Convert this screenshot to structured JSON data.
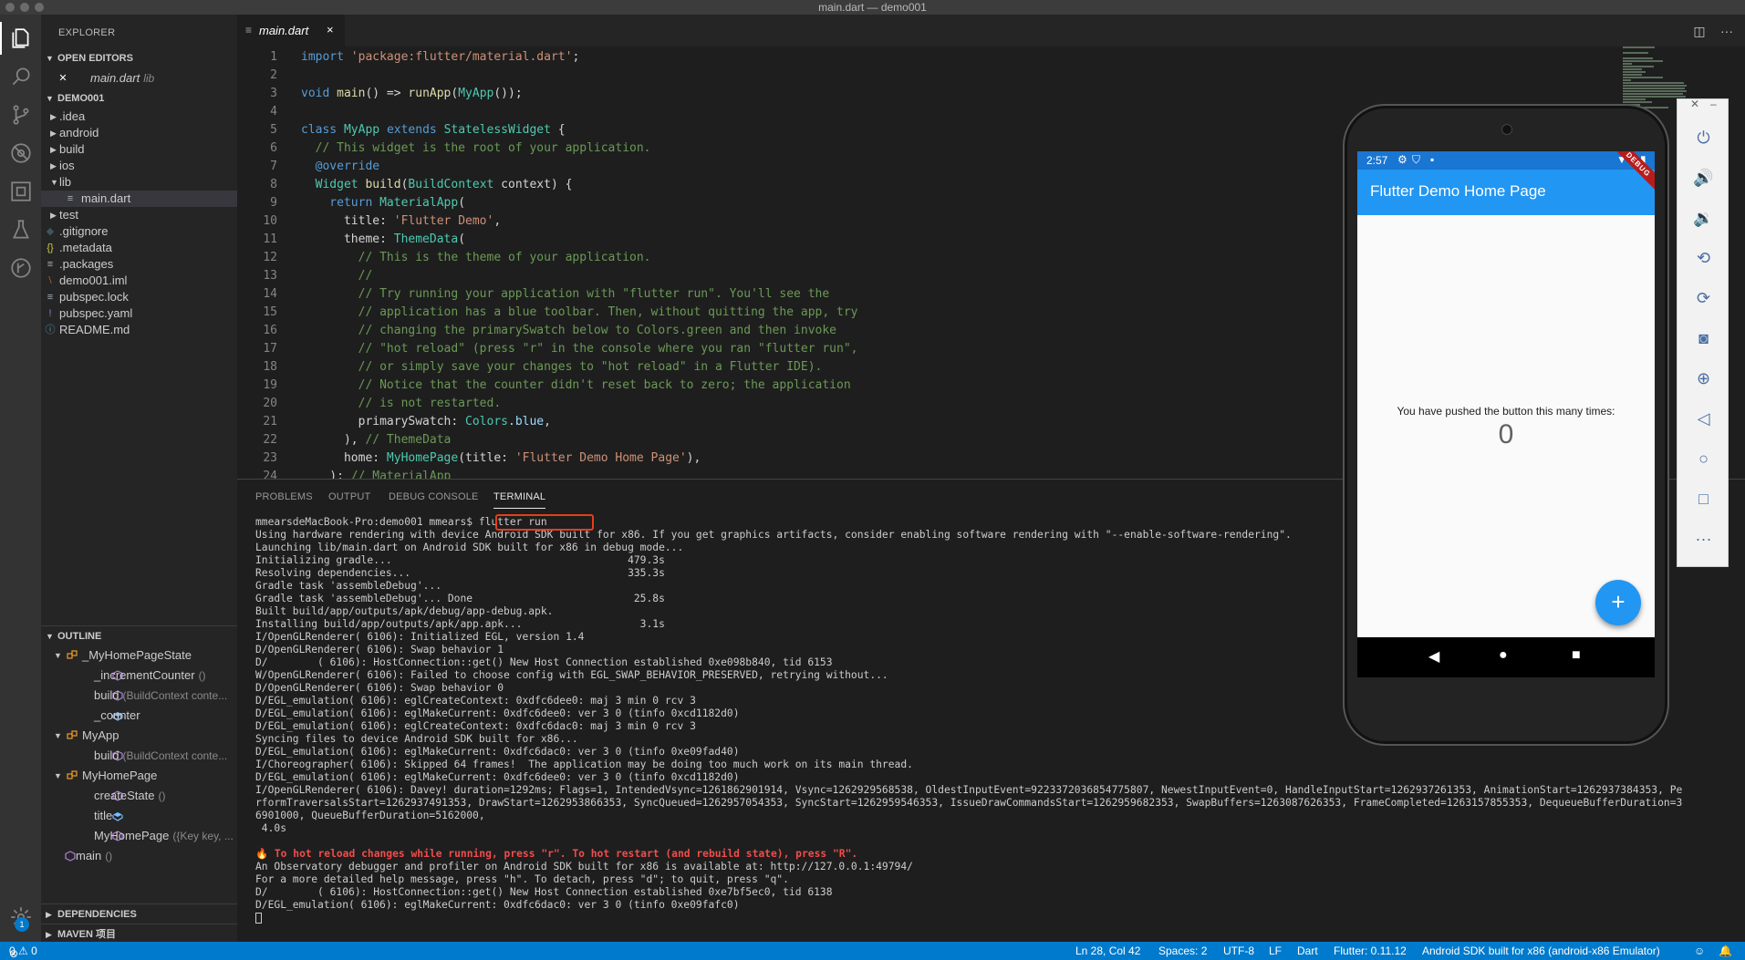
{
  "window": {
    "title": "main.dart — demo001"
  },
  "activity_bar": {
    "items": [
      "files-icon",
      "search-icon",
      "source-control-icon",
      "debug-icon",
      "extensions-icon",
      "test-icon",
      "gitlens-icon"
    ],
    "badge_count": "1"
  },
  "sidebar": {
    "title": "EXPLORER",
    "open_editors": {
      "header": "OPEN EDITORS",
      "items": [
        {
          "name": "main.dart",
          "desc": "lib"
        }
      ]
    },
    "project": {
      "header": "DEMO001",
      "tree": [
        {
          "name": ".idea",
          "type": "folder"
        },
        {
          "name": "android",
          "type": "folder"
        },
        {
          "name": "build",
          "type": "folder"
        },
        {
          "name": "ios",
          "type": "folder"
        },
        {
          "name": "lib",
          "type": "folder-open"
        },
        {
          "name": "main.dart",
          "type": "file"
        },
        {
          "name": "test",
          "type": "folder"
        },
        {
          "name": ".gitignore",
          "type": "file"
        },
        {
          "name": ".metadata",
          "type": "file"
        },
        {
          "name": ".packages",
          "type": "file"
        },
        {
          "name": "demo001.iml",
          "type": "file"
        },
        {
          "name": "pubspec.lock",
          "type": "file"
        },
        {
          "name": "pubspec.yaml",
          "type": "file"
        },
        {
          "name": "README.md",
          "type": "file"
        }
      ]
    },
    "outline": {
      "header": "OUTLINE",
      "items": [
        {
          "name": "_MyHomePageState",
          "desc": "",
          "kind": "class"
        },
        {
          "name": "_incrementCounter",
          "desc": "()",
          "kind": "method"
        },
        {
          "name": "build",
          "desc": "(BuildContext conte...",
          "kind": "method"
        },
        {
          "name": "_counter",
          "desc": "",
          "kind": "field"
        },
        {
          "name": "MyApp",
          "desc": "",
          "kind": "class"
        },
        {
          "name": "build",
          "desc": "(BuildContext conte...",
          "kind": "method"
        },
        {
          "name": "MyHomePage",
          "desc": "",
          "kind": "class"
        },
        {
          "name": "createState",
          "desc": "()",
          "kind": "method"
        },
        {
          "name": "title",
          "desc": "",
          "kind": "field"
        },
        {
          "name": "MyHomePage",
          "desc": "({Key key, ...",
          "kind": "method"
        },
        {
          "name": "main",
          "desc": "()",
          "kind": "method"
        }
      ]
    },
    "dependencies": {
      "header": "DEPENDENCIES"
    },
    "maven": {
      "header": "MAVEN 项目"
    }
  },
  "editor": {
    "tab": {
      "label": "main.dart",
      "close": "×"
    },
    "lines": [
      {
        "n": "1",
        "s": [
          [
            "kw",
            "import "
          ],
          [
            "st",
            "'package:flutter/material.dart'"
          ],
          [
            "id",
            ";"
          ]
        ]
      },
      {
        "n": "2",
        "s": []
      },
      {
        "n": "3",
        "s": [
          [
            "kw",
            "void "
          ],
          [
            "fn",
            "main"
          ],
          [
            "id",
            "() => "
          ],
          [
            "fn",
            "runApp"
          ],
          [
            "id",
            "("
          ],
          [
            "ty",
            "MyApp"
          ],
          [
            "id",
            "());"
          ]
        ]
      },
      {
        "n": "4",
        "s": []
      },
      {
        "n": "5",
        "s": [
          [
            "kw",
            "class "
          ],
          [
            "ty",
            "MyApp "
          ],
          [
            "kw",
            "extends "
          ],
          [
            "ty",
            "StatelessWidget "
          ],
          [
            "id",
            "{"
          ]
        ]
      },
      {
        "n": "6",
        "s": [
          [
            "cm",
            "  // This widget is the root of your application."
          ]
        ]
      },
      {
        "n": "7",
        "s": [
          [
            "kw",
            "  @override"
          ]
        ]
      },
      {
        "n": "8",
        "s": [
          [
            "ty",
            "  Widget "
          ],
          [
            "fn",
            "build"
          ],
          [
            "id",
            "("
          ],
          [
            "ty",
            "BuildContext "
          ],
          [
            "id",
            "context) {"
          ]
        ]
      },
      {
        "n": "9",
        "s": [
          [
            "kw",
            "    return "
          ],
          [
            "ty",
            "MaterialApp"
          ],
          [
            "id",
            "("
          ]
        ]
      },
      {
        "n": "10",
        "s": [
          [
            "id",
            "      title: "
          ],
          [
            "st",
            "'Flutter Demo'"
          ],
          [
            "id",
            ","
          ]
        ]
      },
      {
        "n": "11",
        "s": [
          [
            "id",
            "      theme: "
          ],
          [
            "ty",
            "ThemeData"
          ],
          [
            "id",
            "("
          ]
        ]
      },
      {
        "n": "12",
        "s": [
          [
            "cm",
            "        // This is the theme of your application."
          ]
        ]
      },
      {
        "n": "13",
        "s": [
          [
            "cm",
            "        //"
          ]
        ]
      },
      {
        "n": "14",
        "s": [
          [
            "cm",
            "        // Try running your application with \"flutter run\". You'll see the"
          ]
        ]
      },
      {
        "n": "15",
        "s": [
          [
            "cm",
            "        // application has a blue toolbar. Then, without quitting the app, try"
          ]
        ]
      },
      {
        "n": "16",
        "s": [
          [
            "cm",
            "        // changing the primarySwatch below to Colors.green and then invoke"
          ]
        ]
      },
      {
        "n": "17",
        "s": [
          [
            "cm",
            "        // \"hot reload\" (press \"r\" in the console where you ran \"flutter run\","
          ]
        ]
      },
      {
        "n": "18",
        "s": [
          [
            "cm",
            "        // or simply save your changes to \"hot reload\" in a Flutter IDE)."
          ]
        ]
      },
      {
        "n": "19",
        "s": [
          [
            "cm",
            "        // Notice that the counter didn't reset back to zero; the application"
          ]
        ]
      },
      {
        "n": "20",
        "s": [
          [
            "cm",
            "        // is not restarted."
          ]
        ]
      },
      {
        "n": "21",
        "s": [
          [
            "id",
            "        primarySwatch: "
          ],
          [
            "ty",
            "Colors"
          ],
          [
            "id",
            "."
          ],
          [
            "pr",
            "blue"
          ],
          [
            "id",
            ","
          ]
        ]
      },
      {
        "n": "22",
        "s": [
          [
            "id",
            "      ), "
          ],
          [
            "cm",
            "// ThemeData"
          ]
        ]
      },
      {
        "n": "23",
        "s": [
          [
            "id",
            "      home: "
          ],
          [
            "ty",
            "MyHomePage"
          ],
          [
            "id",
            "(title: "
          ],
          [
            "st",
            "'Flutter Demo Home Page'"
          ],
          [
            "id",
            "),"
          ]
        ]
      },
      {
        "n": "24",
        "s": [
          [
            "id",
            "    ); "
          ],
          [
            "cm",
            "// MaterialApp"
          ]
        ]
      }
    ]
  },
  "panel": {
    "tabs": [
      "PROBLEMS",
      "OUTPUT",
      "DEBUG CONSOLE",
      "TERMINAL"
    ],
    "active_tab": "TERMINAL",
    "terminal_lines": [
      "mmearsdeMacBook-Pro:demo001 mmears$ flutter run",
      "Using hardware rendering with device Android SDK built for x86. If you get graphics artifacts, consider enabling software rendering with \"--enable-software-rendering\".",
      "Launching lib/main.dart on Android SDK built for x86 in debug mode...",
      "Initializing gradle...                                      479.3s",
      "Resolving dependencies...                                   335.3s",
      "Gradle task 'assembleDebug'...",
      "Gradle task 'assembleDebug'... Done                          25.8s",
      "Built build/app/outputs/apk/debug/app-debug.apk.",
      "Installing build/app/outputs/apk/app.apk...                   3.1s",
      "I/OpenGLRenderer( 6106): Initialized EGL, version 1.4",
      "D/OpenGLRenderer( 6106): Swap behavior 1",
      "D/        ( 6106): HostConnection::get() New Host Connection established 0xe098b840, tid 6153",
      "W/OpenGLRenderer( 6106): Failed to choose config with EGL_SWAP_BEHAVIOR_PRESERVED, retrying without...",
      "D/OpenGLRenderer( 6106): Swap behavior 0",
      "D/EGL_emulation( 6106): eglCreateContext: 0xdfc6dee0: maj 3 min 0 rcv 3",
      "D/EGL_emulation( 6106): eglMakeCurrent: 0xdfc6dee0: ver 3 0 (tinfo 0xcd1182d0)",
      "D/EGL_emulation( 6106): eglCreateContext: 0xdfc6dac0: maj 3 min 0 rcv 3",
      "Syncing files to device Android SDK built for x86...",
      "D/EGL_emulation( 6106): eglMakeCurrent: 0xdfc6dac0: ver 3 0 (tinfo 0xe09fad40)",
      "I/Choreographer( 6106): Skipped 64 frames!  The application may be doing too much work on its main thread.",
      "D/EGL_emulation( 6106): eglMakeCurrent: 0xdfc6dee0: ver 3 0 (tinfo 0xcd1182d0)",
      "I/OpenGLRenderer( 6106): Davey! duration=1292ms; Flags=1, IntendedVsync=1261862901914, Vsync=1262929568538, OldestInputEvent=9223372036854775807, NewestInputEvent=0, HandleInputStart=1262937261353, AnimationStart=1262937384353, Pe",
      "rformTraversalsStart=1262937491353, DrawStart=1262953866353, SyncQueued=1262957054353, SyncStart=1262959546353, IssueDrawCommandsStart=1262959682353, SwapBuffers=1263087626353, FrameCompleted=1263157855353, DequeueBufferDuration=3",
      "6901000, QueueBufferDuration=5162000,",
      " 4.0s",
      "",
      "🔥 To hot reload changes while running, press \"r\". To hot restart (and rebuild state), press \"R\".",
      "An Observatory debugger and profiler on Android SDK built for x86 is available at: http://127.0.0.1:49794/",
      "For a more detailed help message, press \"h\". To detach, press \"d\"; to quit, press \"q\".",
      "D/        ( 6106): HostConnection::get() New Host Connection established 0xe7bf5ec0, tid 6138",
      "D/EGL_emulation( 6106): eglMakeCurrent: 0xdfc6dac0: ver 3 0 (tinfo 0xe09fafc0)"
    ]
  },
  "statusbar": {
    "errors": "0",
    "warnings": "0",
    "position": "Ln 28, Col 42",
    "spaces": "Spaces: 2",
    "encoding": "UTF-8",
    "eol": "LF",
    "language": "Dart",
    "flutter": "Flutter: 0.11.12",
    "device": "Android SDK built for x86 (android-x86 Emulator)"
  },
  "emulator": {
    "time": "2:57",
    "app_title": "Flutter Demo Home Page",
    "debug_banner": "DEBUG",
    "message": "You have pushed the button this many times:",
    "counter": "0",
    "fab": "+",
    "toolbar": [
      "power-icon",
      "volume-up-icon",
      "volume-down-icon",
      "rotate-left-icon",
      "rotate-right-icon",
      "camera-icon",
      "zoom-icon",
      "back-icon",
      "home-icon",
      "overview-icon",
      "more-icon"
    ]
  }
}
